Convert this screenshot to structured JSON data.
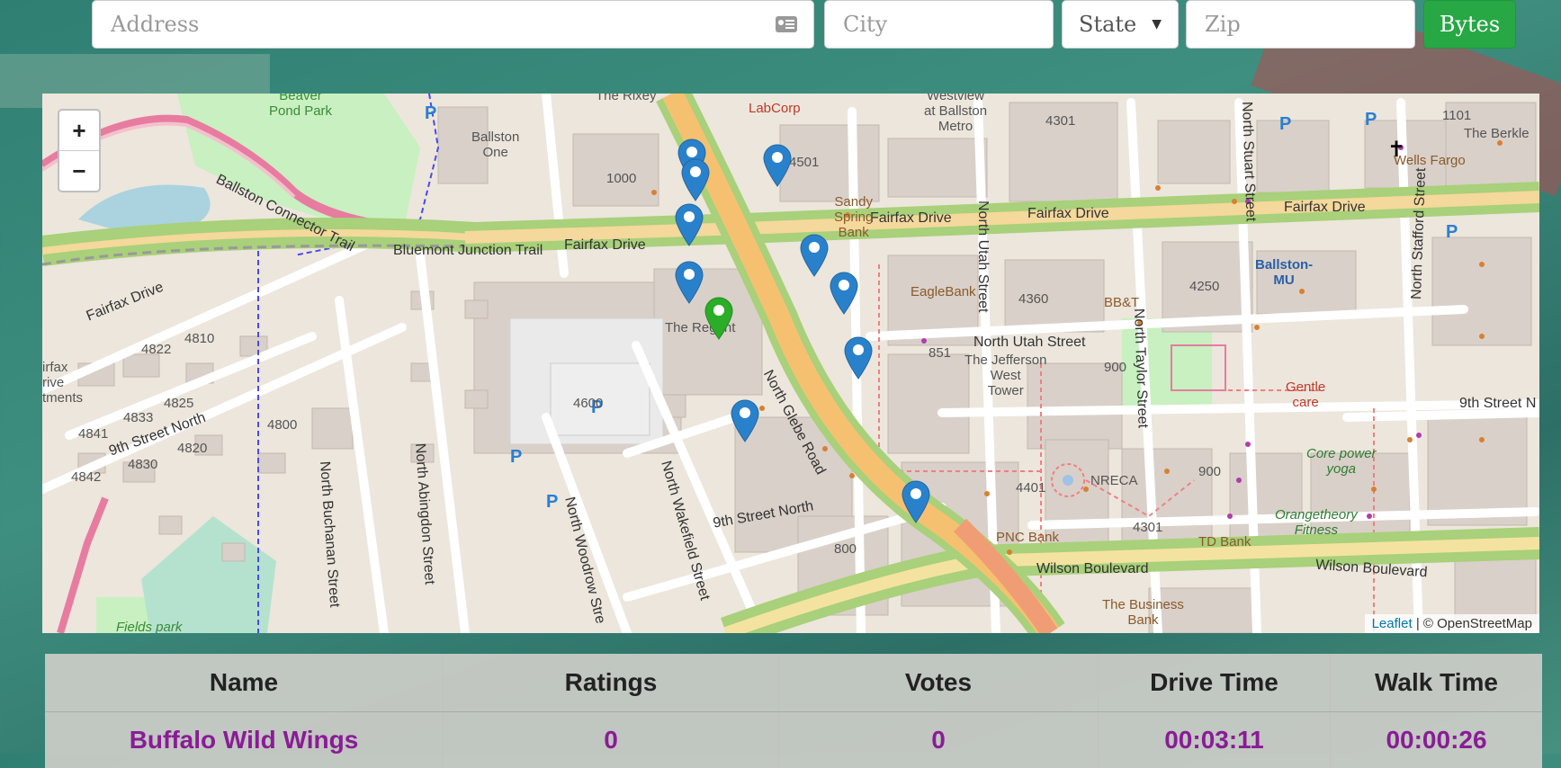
{
  "search": {
    "address_placeholder": "Address",
    "city_placeholder": "City",
    "state_value": "State",
    "zip_placeholder": "Zip",
    "submit_label": "Bytes"
  },
  "map": {
    "zoom_in": "+",
    "zoom_out": "−",
    "attribution_link": "Leaflet",
    "attribution_text": "| © OpenStreetMap",
    "labels": {
      "beaver_pond_park": "Beaver\nPond Park",
      "ballston_one": "Ballston\nOne",
      "ballston_connector_trail": "Ballston Connector Trail",
      "bluemont_junction_trail": "Bluemont Junction Trail",
      "fairfax_drive_1": "Fairfax Drive",
      "fairfax_drive_2": "Fairfax Drive",
      "fairfax_drive_3": "Fairfax Drive",
      "fairfax_drive_4": "Fairfax Drive",
      "fairfax_drive_west": "Fairfax Drive",
      "labcorp": "LabCorp",
      "the_rixey": "The Rixey",
      "westview": "Westview\nat Ballston\nMetro",
      "sandy_spring_bank": "Sandy\nSpring\nBank",
      "eaglebank": "EagleBank",
      "bbt": "BB&T",
      "ballston_mu": "Ballston-\nMU",
      "wells_fargo": "Wells Fargo",
      "the_berkley": "The Berkle",
      "gentle_care": "Gentle\ncare",
      "core_power_yoga": "Core power\nyoga",
      "orangetheory": "Orangetheory\nFitness",
      "the_jefferson": "The Jefferson\nWest\nTower",
      "nreca": "NRECA",
      "pnc_bank": "PNC Bank",
      "td_bank": "TD Bank",
      "the_business_bank": "The Business\nBank",
      "wilson_blvd_1": "Wilson Boulevard",
      "wilson_blvd_2": "Wilson Boulevard",
      "north_glebe_road": "North Glebe Road",
      "north_utah_street": "North Utah Street",
      "north_utah_street_2": "North Utah Street",
      "north_taylor_street": "North Taylor Street",
      "north_stafford_street": "North Stafford Street",
      "north_stuart_street": "North Stuart Street",
      "ninth_street_north_1": "9th Street North",
      "ninth_street_north_2": "9th Street North",
      "ninth_street_north_3": "9th Street N",
      "north_abingdon_street": "North Abingdon Street",
      "north_buchanan_street": "North Buchanan Street",
      "north_woodrow_street": "North Woodrow Stre",
      "north_wakefield_street": "North Wakefield Street",
      "the_regent": "The Regent",
      "fields_park": "Fields park",
      "fairfax_drive_apts": "irfax\nrive\ntments",
      "bldg_1000": "1000",
      "bldg_4501": "4501",
      "bldg_4301": "4301",
      "bldg_4600": "4600",
      "bldg_4360": "4360",
      "bldg_4250": "4250",
      "bldg_851": "851",
      "bldg_900": "900",
      "bldg_900b": "900",
      "bldg_800": "800",
      "bldg_4401": "4401",
      "bldg_4301b": "4301",
      "bldg_4822": "4822",
      "bldg_4810": "4810",
      "bldg_4800": "4800",
      "bldg_4825": "4825",
      "bldg_4830": "4830",
      "bldg_4842": "4842",
      "bldg_4841": "4841",
      "bldg_4833": "4833",
      "bldg_4820": "4820",
      "bldg_1101": "1101"
    }
  },
  "table": {
    "headers": [
      "Name",
      "Ratings",
      "Votes",
      "Drive Time",
      "Walk Time"
    ],
    "rows": [
      [
        "Buffalo Wild Wings",
        "0",
        "0",
        "00:03:11",
        "00:00:26"
      ]
    ]
  },
  "colors": {
    "submit_green": "#28a745",
    "marker_blue": "#2a81cb",
    "marker_green": "#2aad27",
    "result_text": "#8a1c96"
  }
}
